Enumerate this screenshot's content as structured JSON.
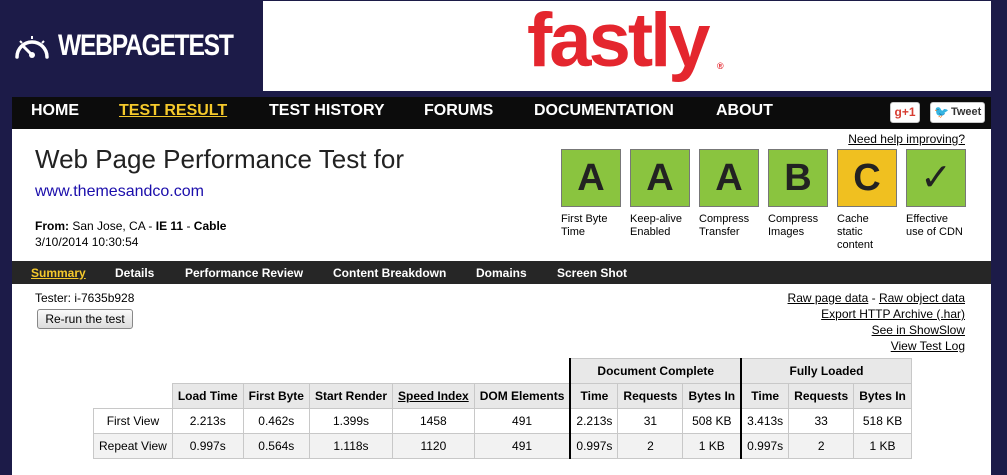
{
  "header": {
    "logo_text": "WEBPAGETEST",
    "ad_text": "fastly",
    "ad_reg": "®"
  },
  "nav": {
    "items": [
      "HOME",
      "TEST RESULT",
      "TEST HISTORY",
      "FORUMS",
      "DOCUMENTATION",
      "ABOUT"
    ],
    "active": "TEST RESULT",
    "gplus": "g+1",
    "tweet": "Tweet"
  },
  "summary": {
    "help_link": "Need help improving?",
    "title": "Web Page Performance Test for",
    "url": "www.themesandco.com",
    "from_label": "From:",
    "from_location": "San Jose, CA",
    "browser": "IE 11",
    "connection": "Cable",
    "date": "3/10/2014 10:30:54"
  },
  "grades": [
    {
      "grade": "A",
      "label": "First Byte Time",
      "color": "#8ac43f"
    },
    {
      "grade": "A",
      "label": "Keep-alive Enabled",
      "color": "#8ac43f"
    },
    {
      "grade": "A",
      "label": "Compress Transfer",
      "color": "#8ac43f"
    },
    {
      "grade": "B",
      "label": "Compress Images",
      "color": "#8ac43f"
    },
    {
      "grade": "C",
      "label": "Cache static content",
      "color": "#f0c020"
    },
    {
      "grade": "✓",
      "label": "Effective use of CDN",
      "color": "#8ac43f"
    }
  ],
  "subnav": {
    "items": [
      "Summary",
      "Details",
      "Performance Review",
      "Content Breakdown",
      "Domains",
      "Screen Shot"
    ],
    "active": "Summary"
  },
  "tester": "Tester: i-7635b928",
  "rerun_label": "Re-run the test",
  "links": {
    "raw_page_data": "Raw page data",
    "dash": " - ",
    "raw_object_data": "Raw object data",
    "export_har": "Export HTTP Archive (.har)",
    "showslow": "See in ShowSlow",
    "test_log": "View Test Log"
  },
  "table": {
    "group_headers": [
      "Document Complete",
      "Fully Loaded"
    ],
    "columns": [
      "Load Time",
      "First Byte",
      "Start Render",
      "Speed Index",
      "DOM Elements",
      "Time",
      "Requests",
      "Bytes In",
      "Time",
      "Requests",
      "Bytes In"
    ],
    "rows": [
      {
        "label": "First View",
        "values": [
          "2.213s",
          "0.462s",
          "1.399s",
          "1458",
          "491",
          "2.213s",
          "31",
          "508 KB",
          "3.413s",
          "33",
          "518 KB"
        ]
      },
      {
        "label": "Repeat View",
        "values": [
          "0.997s",
          "0.564s",
          "1.118s",
          "1120",
          "491",
          "0.997s",
          "2",
          "1 KB",
          "0.997s",
          "2",
          "1 KB"
        ]
      }
    ]
  }
}
